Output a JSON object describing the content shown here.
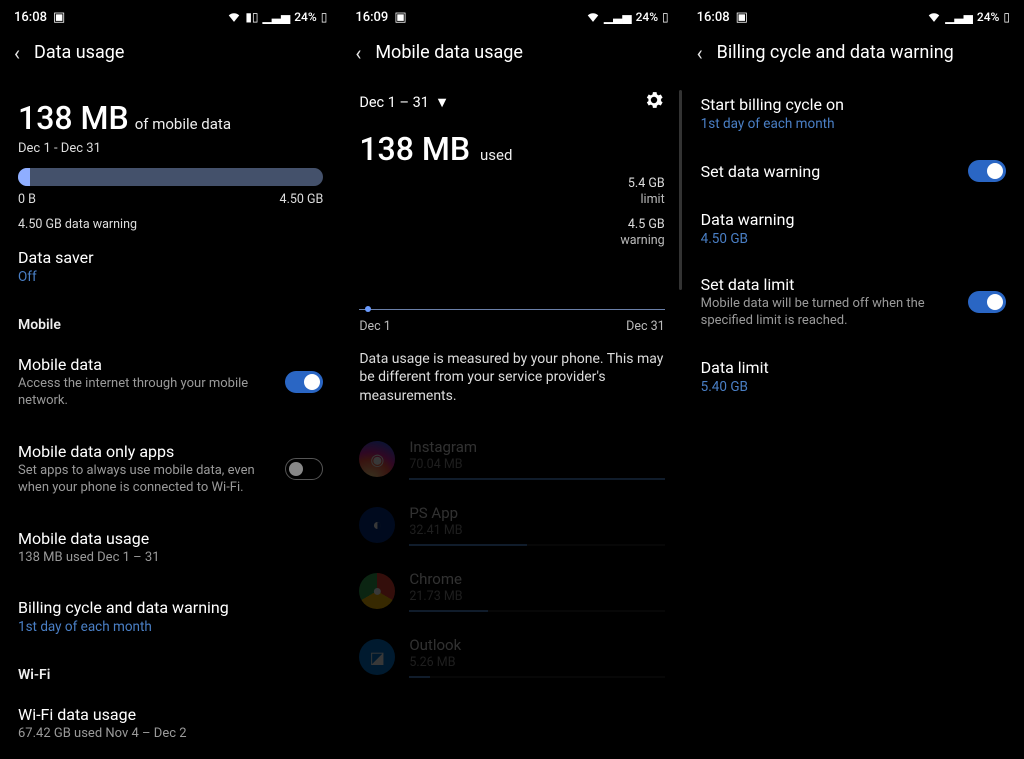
{
  "status": {
    "times": [
      "16:08",
      "16:09",
      "16:08"
    ],
    "battery": "24%"
  },
  "panel1": {
    "title": "Data usage",
    "total_amount": "138 MB",
    "total_suffix": "of mobile data",
    "range": "Dec 1 - Dec 31",
    "bar_left": "0 B",
    "bar_right": "4.50 GB",
    "warning": "4.50 GB data warning",
    "data_saver": {
      "title": "Data saver",
      "value": "Off"
    },
    "section_mobile": "Mobile",
    "mobile_data": {
      "title": "Mobile data",
      "sub": "Access the internet through your mobile network.",
      "on": true
    },
    "mobile_only_apps": {
      "title": "Mobile data only apps",
      "sub": "Set apps to always use mobile data, even when your phone is connected to Wi-Fi.",
      "on": false
    },
    "mobile_usage": {
      "title": "Mobile data usage",
      "sub": "138 MB used Dec 1 – 31"
    },
    "billing": {
      "title": "Billing cycle and data warning",
      "sub": "1st day of each month"
    },
    "section_wifi": "Wi-Fi",
    "wifi_usage": {
      "title": "Wi-Fi data usage",
      "sub": "67.42 GB used Nov 4 – Dec 2"
    }
  },
  "panel2": {
    "title": "Mobile data usage",
    "period": "Dec 1 – 31",
    "total_amount": "138 MB",
    "used_label": "used",
    "limit_val": "5.4 GB",
    "limit_label": "limit",
    "warn_val": "4.5 GB",
    "warn_label": "warning",
    "graph_left": "Dec 1",
    "graph_right": "Dec 31",
    "desc": "Data usage is measured by your phone. This may be different from your service provider's measurements.",
    "apps": [
      {
        "name": "Instagram",
        "amount": "70.04 MB",
        "pct": 100
      },
      {
        "name": "PS App",
        "amount": "32.41 MB",
        "pct": 46
      },
      {
        "name": "Chrome",
        "amount": "21.73 MB",
        "pct": 31
      },
      {
        "name": "Outlook",
        "amount": "5.26 MB",
        "pct": 8
      }
    ]
  },
  "panel3": {
    "title": "Billing cycle and data warning",
    "start_cycle": {
      "title": "Start billing cycle on",
      "value": "1st day of each month"
    },
    "set_warning": {
      "title": "Set data warning",
      "on": true
    },
    "data_warning": {
      "title": "Data warning",
      "value": "4.50 GB"
    },
    "set_limit": {
      "title": "Set data limit",
      "sub": "Mobile data will be turned off when the specified limit is reached.",
      "on": true
    },
    "data_limit": {
      "title": "Data limit",
      "value": "5.40 GB"
    }
  }
}
